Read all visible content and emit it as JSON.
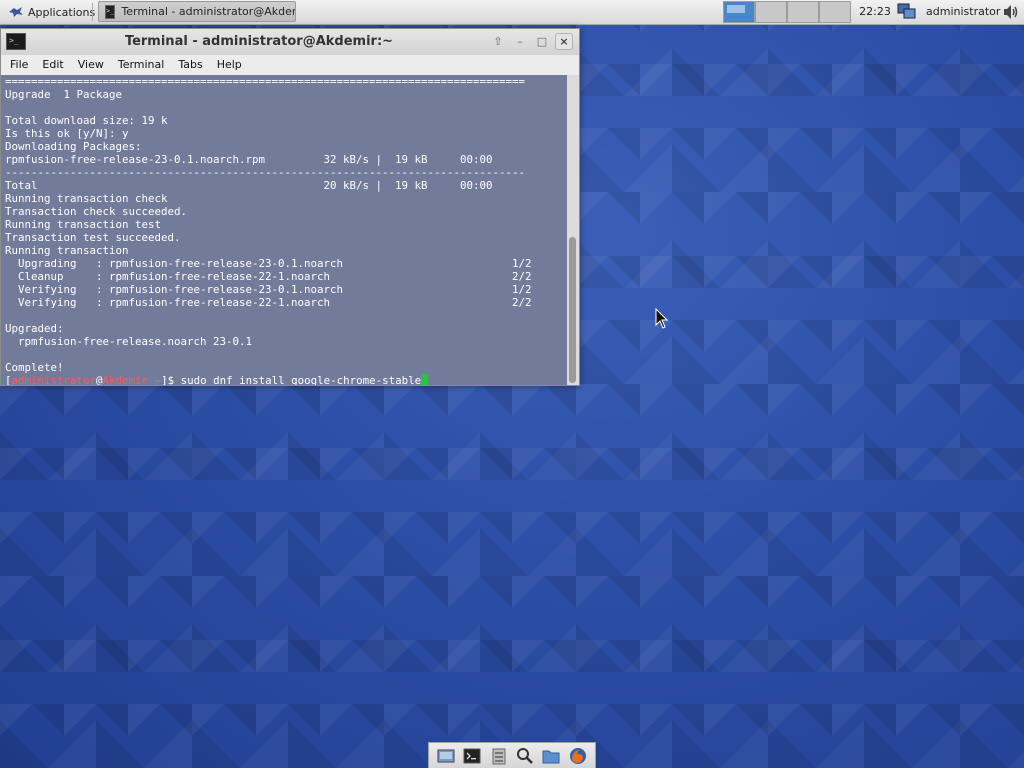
{
  "top_panel": {
    "applications_label": "Applications",
    "task_title": "Terminal - administrator@Akdem...",
    "clock": "22:23",
    "user": "administrator",
    "workspace_count": 4,
    "active_workspace": 1
  },
  "terminal": {
    "title": "Terminal - administrator@Akdemir:~",
    "menu": [
      "File",
      "Edit",
      "View",
      "Terminal",
      "Tabs",
      "Help"
    ],
    "output_lines": [
      "================================================================================",
      "Upgrade  1 Package",
      "",
      "Total download size: 19 k",
      "Is this ok [y/N]: y",
      "Downloading Packages:",
      "rpmfusion-free-release-23-0.1.noarch.rpm         32 kB/s |  19 kB     00:00",
      "--------------------------------------------------------------------------------",
      "Total                                            20 kB/s |  19 kB     00:00",
      "Running transaction check",
      "Transaction check succeeded.",
      "Running transaction test",
      "Transaction test succeeded.",
      "Running transaction",
      "  Upgrading   : rpmfusion-free-release-23-0.1.noarch                          1/2",
      "  Cleanup     : rpmfusion-free-release-22-1.noarch                            2/2",
      "  Verifying   : rpmfusion-free-release-23-0.1.noarch                          1/2",
      "  Verifying   : rpmfusion-free-release-22-1.noarch                            2/2",
      "",
      "Upgraded:",
      "  rpmfusion-free-release.noarch 23-0.1",
      "",
      "Complete!"
    ],
    "prompt": {
      "open_bracket": "[",
      "user": "administrator",
      "at": "@",
      "host": "Akdemir",
      "path": " ~",
      "close": "]$ ",
      "command": "sudo dnf install google-chrome-stable"
    }
  },
  "dock": {
    "items": [
      "show-desktop-icon",
      "terminal-icon",
      "file-manager-icon",
      "search-icon",
      "folder-icon",
      "firefox-icon"
    ]
  },
  "colors": {
    "prompt_user": "#ff5a5a",
    "cursor": "#22c83a",
    "annotation_underline": "#e32020",
    "desktop_blue": "#2c4ea6"
  }
}
